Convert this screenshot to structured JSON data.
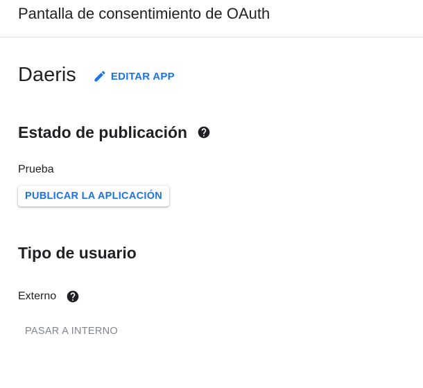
{
  "header": {
    "title": "Pantalla de consentimiento de OAuth"
  },
  "app": {
    "name": "Daeris",
    "edit_label": "EDITAR APP"
  },
  "publishing": {
    "title": "Estado de publicación",
    "status": "Prueba",
    "publish_label": "PUBLICAR LA APLICACIÓN"
  },
  "user_type": {
    "title": "Tipo de usuario",
    "value": "Externo",
    "switch_label": "PASAR A INTERNO"
  },
  "colors": {
    "accent": "#1a73e8",
    "text": "#202124",
    "disabled": "#80868b"
  },
  "icons": {
    "edit": "pencil-icon",
    "help": "help-circle-icon"
  }
}
